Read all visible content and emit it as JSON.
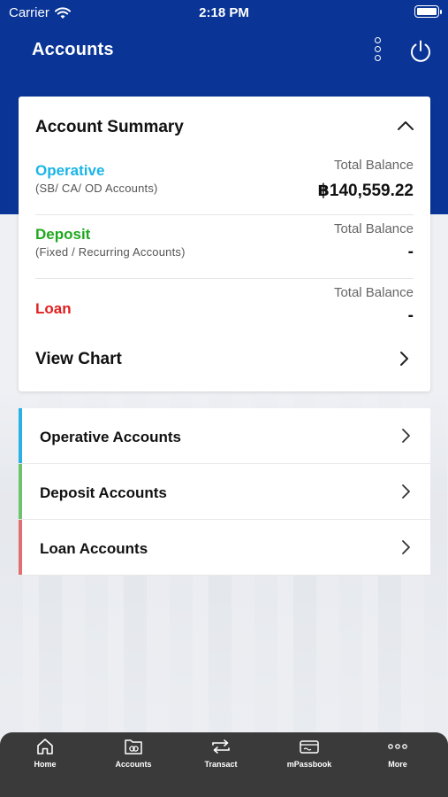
{
  "status_bar": {
    "carrier": "Carrier",
    "time": "2:18 PM"
  },
  "header": {
    "title": "Accounts"
  },
  "summary": {
    "title": "Account Summary",
    "rows": [
      {
        "name": "Operative",
        "subtitle": "(SB/ CA/ OD Accounts)",
        "balance_label": "Total Balance",
        "balance": "฿140,559.22",
        "color": "#1ab4e8"
      },
      {
        "name": "Deposit",
        "subtitle": "(Fixed / Recurring Accounts)",
        "balance_label": "Total Balance",
        "balance": "-",
        "color": "#1fa81f"
      },
      {
        "name": "Loan",
        "subtitle": "",
        "balance_label": "Total Balance",
        "balance": "-",
        "color": "#e02020"
      }
    ],
    "view_chart": "View Chart"
  },
  "account_list": [
    {
      "label": "Operative Accounts",
      "color": "#2ab0e4"
    },
    {
      "label": "Deposit Accounts",
      "color": "#6cc36c"
    },
    {
      "label": "Loan Accounts",
      "color": "#e07070"
    }
  ],
  "tabs": [
    {
      "label": "Home",
      "icon": "home-icon"
    },
    {
      "label": "Accounts",
      "icon": "accounts-folder-icon"
    },
    {
      "label": "Transact",
      "icon": "transfer-arrows-icon"
    },
    {
      "label": "mPassbook",
      "icon": "passbook-card-icon"
    },
    {
      "label": "More",
      "icon": "more-dots-icon"
    }
  ],
  "colors": {
    "header": "#0a3596",
    "tabbar": "#3a3a3a"
  }
}
